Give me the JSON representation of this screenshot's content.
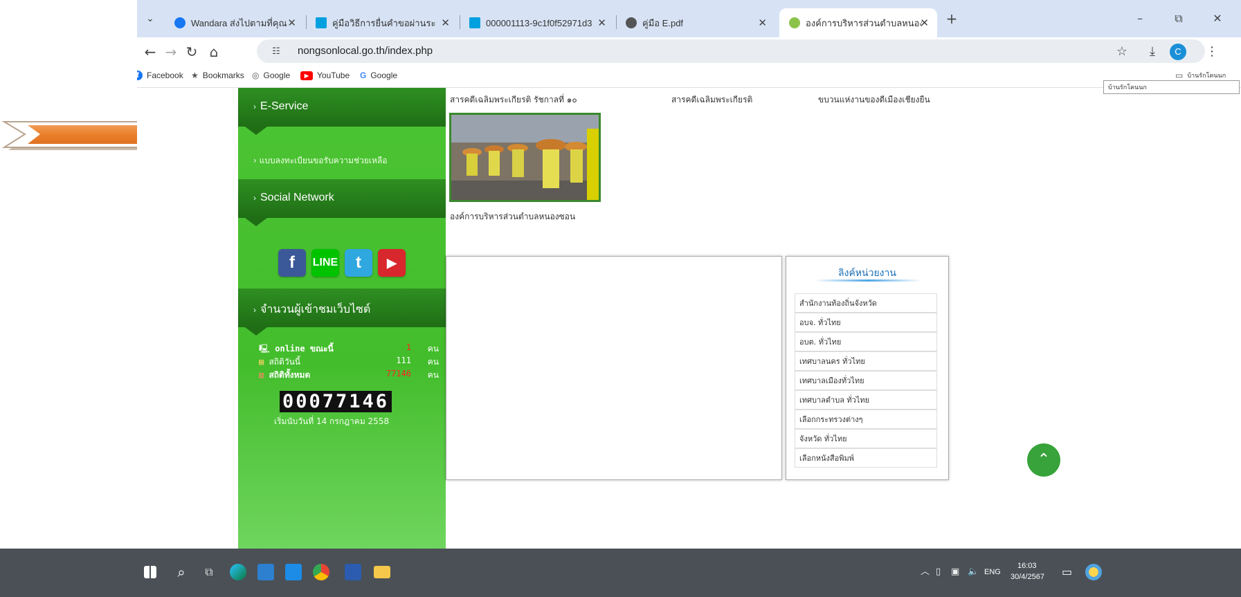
{
  "browser": {
    "tabs": [
      {
        "title": "Wandara ส่งไปตามที่คุณ",
        "favicon_color": "#1877f2"
      },
      {
        "title": "คู่มือวิธีการยื่นคำขอผ่านระบบ บริการ e",
        "favicon_color": "#00a0e0"
      },
      {
        "title": "000001113-9c1f0f52971d3",
        "favicon_color": "#00a0e0"
      },
      {
        "title": "คู่มือ E.pdf",
        "favicon_color": "#555555"
      },
      {
        "title": "องค์การบริหารส่วนตำบลหนองซอน",
        "favicon_color": "#8bc34a",
        "active": true
      }
    ],
    "new_tab": "+",
    "window_controls": {
      "minimize": "–",
      "maximize": "⧉",
      "close": "✕"
    },
    "url": "nongsonlocal.go.th/index.php",
    "avatar_letter": "C",
    "bookmarks": [
      {
        "label": "Facebook",
        "color": "#1877f2",
        "glyph": "f"
      },
      {
        "label": "Bookmarks",
        "color": "#555555",
        "glyph": "★"
      },
      {
        "label": "Google",
        "color": "#555555",
        "glyph": "◎"
      },
      {
        "label": "YouTube",
        "color": "#ff0000",
        "glyph": "▶"
      },
      {
        "label": "Google",
        "color": "#4285f4",
        "glyph": "G"
      }
    ],
    "bookmark_folder": "บ้านรักโคนนก",
    "tooltip": "บ้านรักโคนนก"
  },
  "sidebar": {
    "eservice_title": "E-Service",
    "eservice_link": "› แบบลงทะเบียนขอรับความช่วยเหลือ",
    "social_title": "Social Network",
    "social_icons": [
      {
        "label": "f",
        "color": "#3b5998"
      },
      {
        "label": "💬",
        "color": "#00c300"
      },
      {
        "label": "t",
        "color": "#2fa8e0"
      },
      {
        "label": "▶",
        "color": "#d9272e"
      }
    ],
    "visitors_title": "จำนวนผู้เข้าชมเว็บไซต์",
    "stats": [
      {
        "label": "online ขณะนี้",
        "value": "1",
        "unit": "คน",
        "value_color": "#ff2222"
      },
      {
        "label": "สถิติวันนี้",
        "value": "111",
        "unit": "คน",
        "value_color": "#ffffff"
      },
      {
        "label": "สถิติทั้งหมด",
        "value": "77146",
        "unit": "คน",
        "value_color": "#ff2222"
      }
    ],
    "counter": "00077146",
    "since": "เริ่มนับวันที่ 14 กรกฎาคม 2558"
  },
  "main": {
    "captions": [
      "สารคดีเฉลิมพระเกียรติ รัชกาลที่ ๑๐",
      "สารคดีเฉลิมพระเกียรติ",
      "ขบวนแห่งานของดีเมืองเชียงยืน"
    ],
    "photo_caption": "องค์การบริหารส่วนตำบลหนองซอน",
    "links_title": "ลิงค์หน่วยงาน",
    "links": [
      "สำนักงานท้องถิ่นจังหวัด",
      "อบจ. ทั่วไทย",
      "อบต. ทั่วไทย",
      "เทศบาลนคร ทั่วไทย",
      "เทศบาลเมืองทั่วไทย",
      "เทศบาลตำบล ทั่วไทย",
      "เลือกกระทรวงต่างๆ",
      "จังหวัด ทั่วไทย",
      "เลือกหนังสือพิมพ์"
    ]
  },
  "taskbar": {
    "time": "16:03",
    "date": "30/4/2567",
    "language": "ENG"
  }
}
